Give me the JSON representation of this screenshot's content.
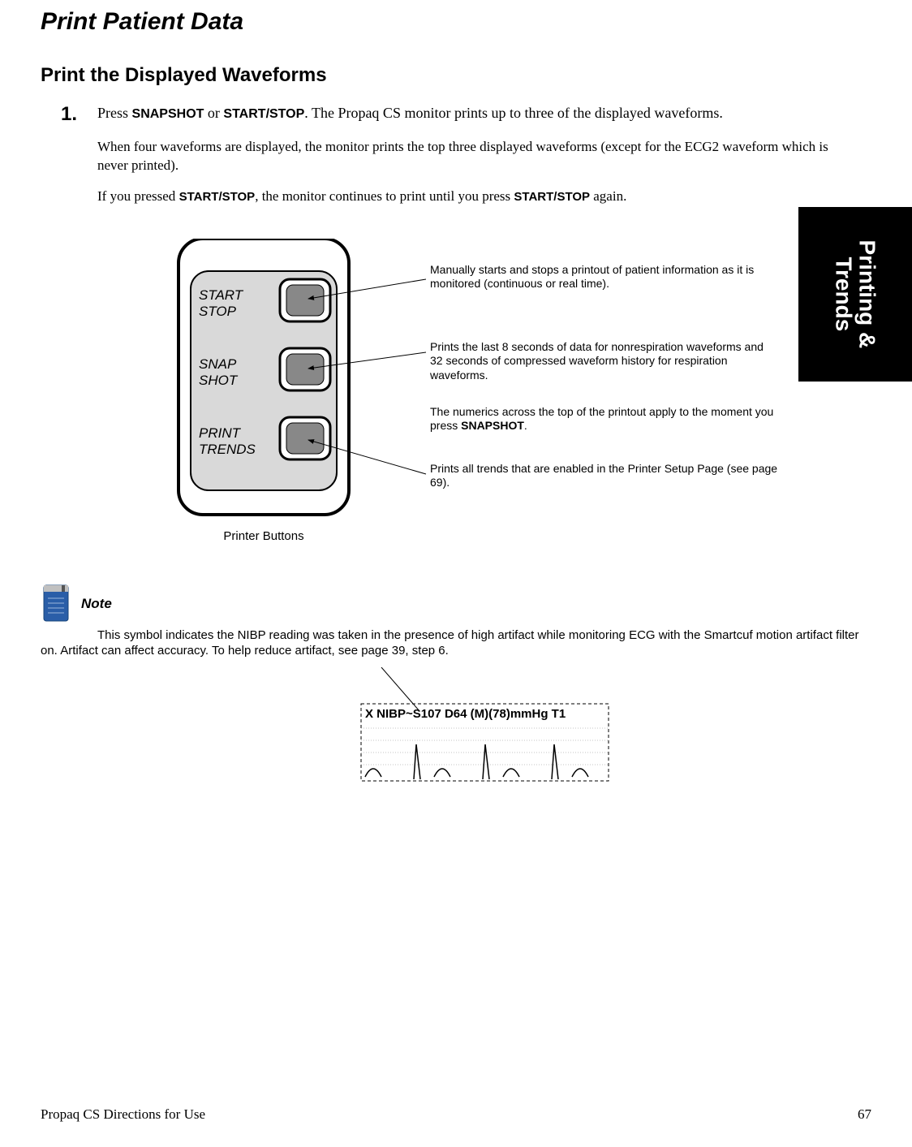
{
  "title": "Print Patient Data",
  "subtitle": "Print the Displayed Waveforms",
  "step": {
    "num": "1.",
    "text_pre": "Press ",
    "key1": "SNAPSHOT",
    "or": " or ",
    "key2": "START/STOP",
    "text_post": ". The Propaq CS monitor prints up to three of the displayed waveforms."
  },
  "para1": "When four waveforms are displayed, the monitor prints the top three displayed waveforms (except for the ECG2 waveform which is never printed).",
  "para2_pre": "If you pressed ",
  "para2_key1": "START/STOP",
  "para2_mid": ", the monitor continues to print until you press ",
  "para2_key2": "START/STOP",
  "para2_post": " again.",
  "side_tab_line1": "Printing &",
  "side_tab_line2": "Trends",
  "buttons": {
    "b1_line1": "START",
    "b1_line2": "STOP",
    "b2_line1": "SNAP",
    "b2_line2": "SHOT",
    "b3_line1": "PRINT",
    "b3_line2": "TRENDS"
  },
  "callout1": "Manually starts and stops a printout of patient information as it is monitored (continuous or real time).",
  "callout2": "Prints the last 8 seconds of data for nonrespiration waveforms and 32 seconds of compressed waveform history for respiration waveforms.",
  "callout3_pre": "The numerics across the top of the printout apply to the moment you press ",
  "callout3_bold": "SNAPSHOT",
  "callout3_post": ".",
  "callout4": "Prints all trends that are enabled in the Printer Setup Page (see page 69).",
  "caption": "Printer Buttons",
  "note_label": "Note",
  "note_text": "This symbol indicates the NIBP reading was taken in the presence of high artifact while monitoring ECG with the Smartcuf motion artifact filter on. Artifact can affect accuracy. To help reduce artifact, see page 39, step 6.",
  "strip_text": "X NIBP~S107 D64 (M)(78)mmHg T1",
  "footer_left": "Propaq CS Directions for Use",
  "footer_right": "67"
}
